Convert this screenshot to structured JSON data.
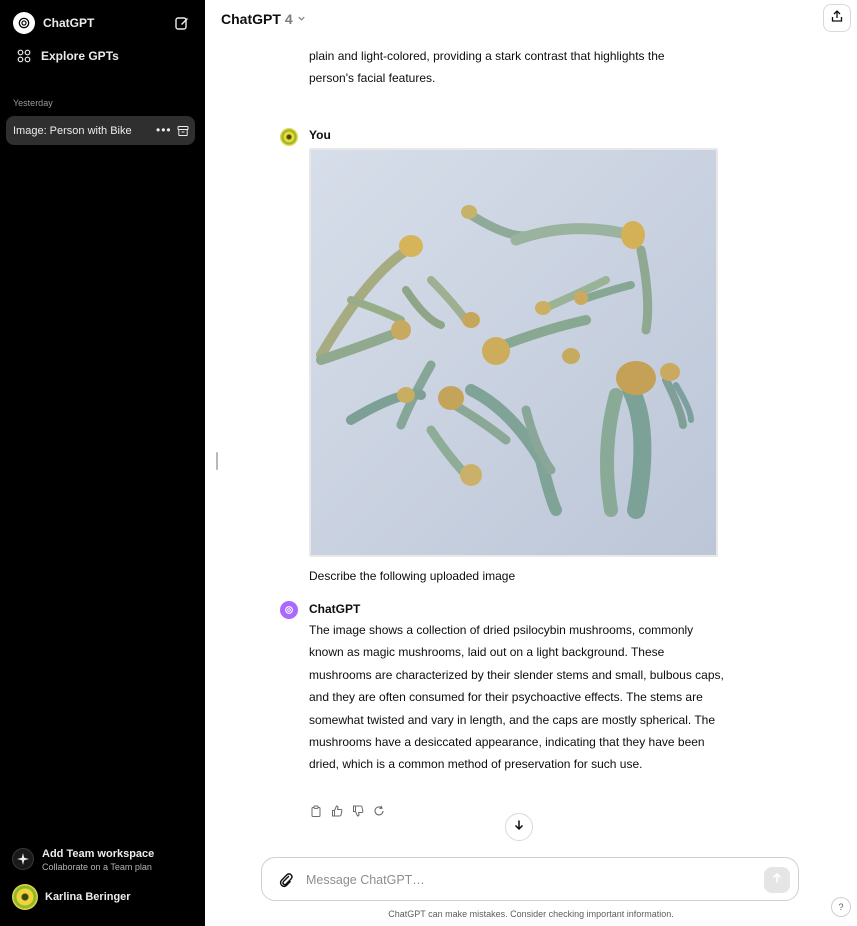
{
  "sidebar": {
    "app_name": "ChatGPT",
    "explore_label": "Explore GPTs",
    "section_label": "Yesterday",
    "conversations": [
      {
        "title": "Image: Person with Bike"
      }
    ],
    "team": {
      "title": "Add Team workspace",
      "subtitle": "Collaborate on a Team plan"
    },
    "user": {
      "name": "Karlina Beringer"
    }
  },
  "header": {
    "model": "ChatGPT",
    "version": "4"
  },
  "chat": {
    "previous_text": "plain and light-colored, providing a stark contrast that highlights the person's facial features.",
    "user_author": "You",
    "user_message": "Describe the following uploaded image",
    "assistant_author": "ChatGPT",
    "assistant_message": "The image shows a collection of dried psilocybin mushrooms, commonly known as magic mushrooms, laid out on a light background. These mushrooms are characterized by their slender stems and small, bulbous caps, and they are often consumed for their psychoactive effects. The stems are somewhat twisted and vary in length, and the caps are mostly spherical. The mushrooms have a desiccated appearance, indicating that they have been dried, which is a common method of preservation for such use."
  },
  "composer": {
    "placeholder": "Message ChatGPT…",
    "disclaimer": "ChatGPT can make mistakes. Consider checking important information.",
    "help": "?"
  },
  "icons": {
    "new_chat": "edit-icon",
    "explore": "grid-icon",
    "share": "share-icon",
    "attach": "paperclip-icon",
    "send": "arrow-up-icon",
    "scroll": "arrow-down-icon"
  },
  "colors": {
    "sidebar_bg": "#000000",
    "active_item_bg": "#2f2f2f",
    "gpt_avatar": "#ab68ff"
  }
}
